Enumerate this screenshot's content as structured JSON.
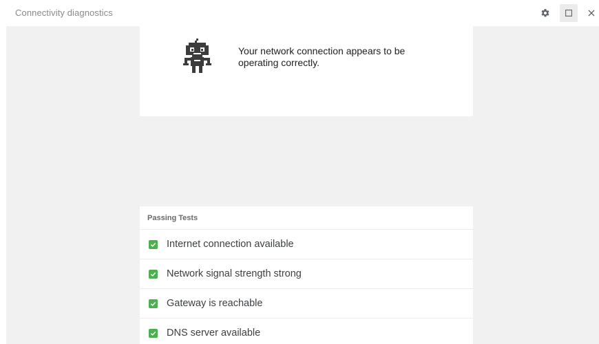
{
  "window": {
    "title": "Connectivity diagnostics",
    "controls": {
      "settings_icon": "gear-icon",
      "maximize_icon": "maximize-icon",
      "close_icon": "close-icon"
    }
  },
  "status": {
    "icon": "robot-icon",
    "message": "Your network connection appears to be operating correctly."
  },
  "passing_tests": {
    "header": "Passing Tests",
    "items": [
      {
        "label": "Internet connection available",
        "status": "passed"
      },
      {
        "label": "Network signal strength strong",
        "status": "passed"
      },
      {
        "label": "Gateway is reachable",
        "status": "passed"
      },
      {
        "label": "DNS server available",
        "status": "passed"
      }
    ]
  },
  "colors": {
    "check_green": "#4caf50",
    "content_bg": "#f1f1f1",
    "title_gray": "#8a8a8a",
    "robot_dark": "#3c3c3c"
  }
}
